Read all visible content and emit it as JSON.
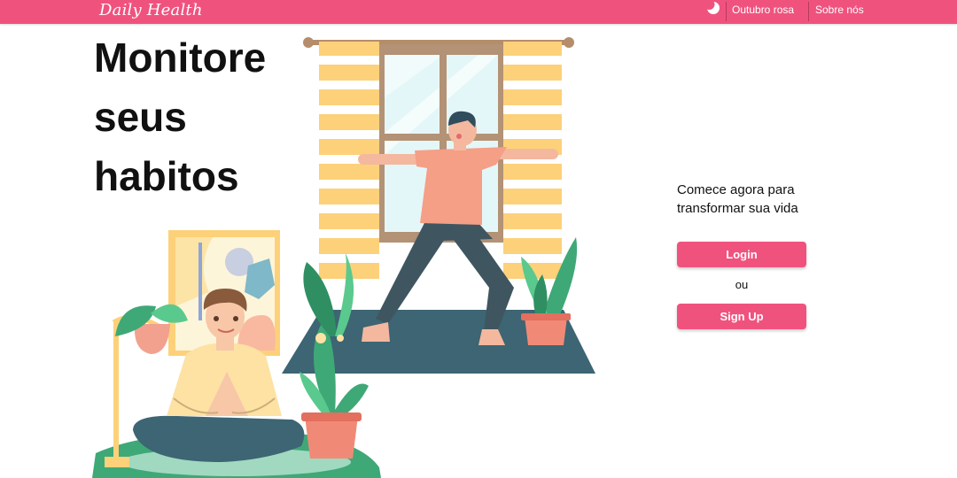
{
  "navbar": {
    "brand": "Daily Health",
    "theme_toggle_icon": "moon-icon",
    "links": [
      "Outubro rosa",
      "Sobre nós"
    ]
  },
  "hero": {
    "title_lines": [
      "Monitore",
      "seus",
      "habitos"
    ]
  },
  "cta": {
    "text_lines": [
      "Comece agora para",
      "transformar sua vida"
    ],
    "login_label": "Login",
    "or_label": "ou",
    "signup_label": "Sign Up"
  },
  "colors": {
    "brand_pink": "#f0527e",
    "curtain_yellow": "#fdd17a",
    "mat_slate": "#3d6573",
    "plant_green": "#3fa877"
  }
}
